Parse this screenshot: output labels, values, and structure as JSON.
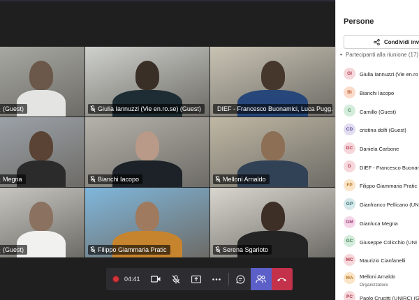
{
  "meeting": {
    "recording_time": "04:41"
  },
  "tiles": [
    {
      "name": "(Guest)",
      "colors": {
        "bg": "#a8a9a3",
        "person": "#6b584a",
        "body": "#e4e5e3"
      }
    },
    {
      "name": "Giulia Iannuzzi (Vie en.ro.se) (Guest)",
      "colors": {
        "bg": "#cfd1cc",
        "person": "#3a2f27",
        "body": "#1e2d33"
      }
    },
    {
      "name": "DIEF - Francesco Buonamici, Luca Pugg...",
      "colors": {
        "bg": "#c9c3b3",
        "person": "#45372c",
        "body": "#27477a"
      }
    },
    {
      "name": "Megna",
      "colors": {
        "bg": "#9ca2a9",
        "person": "#5a4334",
        "body": "#2b2b2b"
      }
    },
    {
      "name": "Bianchi Iacopo",
      "colors": {
        "bg": "#b5b2aa",
        "person": "#b99a88",
        "body": "#1c2227"
      }
    },
    {
      "name": "Melloni Arnaldo",
      "colors": {
        "bg": "#c0b8a4",
        "person": "#8d6f55",
        "body": "#324256"
      }
    },
    {
      "name": "(Guest)",
      "colors": {
        "bg": "#c8c6c1",
        "person": "#8b7260",
        "body": "#f1f1ef"
      }
    },
    {
      "name": "Filippo Giammaria Pratic",
      "colors": {
        "bg": "#7fb7dc",
        "person": "#9f7a5e",
        "body": "#c7842e"
      }
    },
    {
      "name": "Serena Sgarioto",
      "colors": {
        "bg": "#d9d6cf",
        "person": "#3e2f26",
        "body": "#242424"
      }
    }
  ],
  "panel": {
    "title": "Persone",
    "share_label": "Condividi invit",
    "section_label": "Partecipanti alla riunione (17)",
    "participants": [
      {
        "initials": "GI",
        "name": "Giulia Iannuzzi (Vie en.ro",
        "role": "",
        "bg": "#f6d7db",
        "fg": "#b0384a"
      },
      {
        "initials": "BI",
        "name": "Bianchi Iacopo",
        "role": "",
        "bg": "#fbdccb",
        "fg": "#c0592a"
      },
      {
        "initials": "C",
        "name": "Camillo (Guest)",
        "role": "",
        "bg": "#d4ecdb",
        "fg": "#3a7d4f"
      },
      {
        "initials": "CD",
        "name": "cristina dolfi (Guest)",
        "role": "",
        "bg": "#e2dcf1",
        "fg": "#5b4a9b"
      },
      {
        "initials": "DC",
        "name": "Daniela Carbone",
        "role": "",
        "bg": "#f6d7db",
        "fg": "#b0384a"
      },
      {
        "initials": "D",
        "name": "DIEF - Francesco Buonam",
        "role": "",
        "bg": "#f6d7db",
        "fg": "#b0384a"
      },
      {
        "initials": "FP",
        "name": "Filippo Giammaria Pratic",
        "role": "",
        "bg": "#fbe5c8",
        "fg": "#b6731e"
      },
      {
        "initials": "GP",
        "name": "Gianfranco Pellicano (UN",
        "role": "",
        "bg": "#d5e8ea",
        "fg": "#2f6d73"
      },
      {
        "initials": "GM",
        "name": "Gianluca Megna",
        "role": "",
        "bg": "#f4d6e8",
        "fg": "#9c3a77"
      },
      {
        "initials": "GC",
        "name": "Giuseppe Colicchio (UNI",
        "role": "",
        "bg": "#d4ecdb",
        "fg": "#3a7d4f"
      },
      {
        "initials": "MC",
        "name": "Maurizio Cianfanelli",
        "role": "",
        "bg": "#f6d7db",
        "fg": "#b0384a"
      },
      {
        "initials": "MA",
        "name": "Melloni Arnaldo",
        "role": "Organizzatore",
        "bg": "#fbe5c8",
        "fg": "#b6731e"
      },
      {
        "initials": "PC",
        "name": "Paolo Crucitti (UNIRC) (G",
        "role": "",
        "bg": "#f6d7db",
        "fg": "#b0384a"
      }
    ]
  }
}
